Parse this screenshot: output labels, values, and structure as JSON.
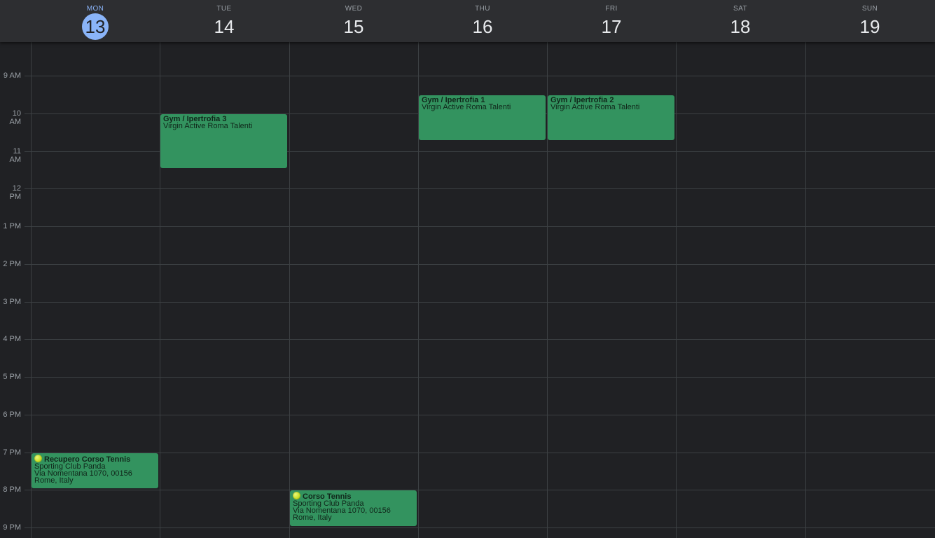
{
  "days": [
    {
      "dow": "MON",
      "num": "13",
      "today": true
    },
    {
      "dow": "TUE",
      "num": "14",
      "today": false
    },
    {
      "dow": "WED",
      "num": "15",
      "today": false
    },
    {
      "dow": "THU",
      "num": "16",
      "today": false
    },
    {
      "dow": "FRI",
      "num": "17",
      "today": false
    },
    {
      "dow": "SAT",
      "num": "18",
      "today": false
    },
    {
      "dow": "SUN",
      "num": "19",
      "today": false
    }
  ],
  "hour_labels": [
    "9 AM",
    "10 AM",
    "11 AM",
    "12 PM",
    "1 PM",
    "2 PM",
    "3 PM",
    "4 PM",
    "5 PM",
    "6 PM",
    "7 PM",
    "8 PM",
    "9 PM"
  ],
  "events": [
    {
      "day": 1,
      "start": "10:00",
      "end": "11:30",
      "title": "Gym / Ipertrofia 3",
      "lines": [
        "Virgin Active Roma Talenti"
      ],
      "icon": null
    },
    {
      "day": 3,
      "start": "9:30",
      "end": "10:45",
      "title": "Gym / Ipertrofia 1",
      "lines": [
        "Virgin Active Roma Talenti"
      ],
      "icon": null
    },
    {
      "day": 4,
      "start": "9:30",
      "end": "10:45",
      "title": "Gym / Ipertrofia 2",
      "lines": [
        "Virgin Active Roma Talenti"
      ],
      "icon": null
    },
    {
      "day": 0,
      "start": "19:00",
      "end": "20:00",
      "title": "Recupero Corso Tennis",
      "lines": [
        "Sporting Club Panda",
        "Via Nomentana 1070, 00156 Rome, Italy"
      ],
      "icon": "tennis-ball-icon"
    },
    {
      "day": 2,
      "start": "20:00",
      "end": "21:00",
      "title": "Corso Tennis",
      "lines": [
        "Sporting Club Panda",
        "Via Nomentana 1070, 00156 Rome, Italy"
      ],
      "icon": "tennis-ball-icon"
    }
  ],
  "colors": {
    "background": "#202124",
    "header": "#2d2e31",
    "gridline": "#3c4043",
    "today_accent": "#8ab4f8",
    "event": "#33935f"
  }
}
